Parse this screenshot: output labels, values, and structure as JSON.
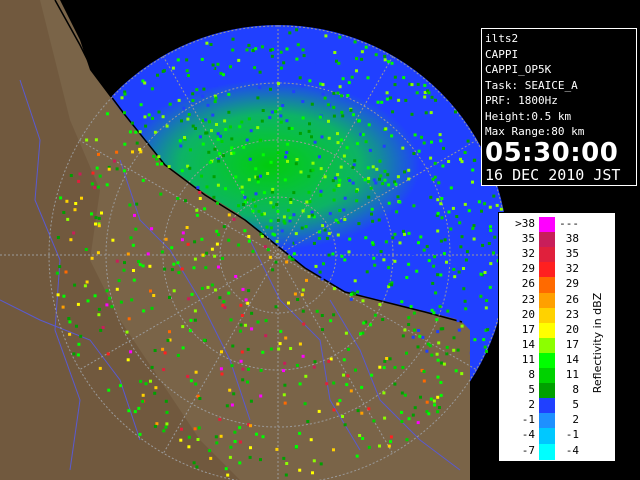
{
  "info": {
    "radar_name": "ilts2",
    "product": "CAPPI",
    "product_name": "CAPPI_OP5K",
    "task": "Task: SEAICE_A",
    "prf": "PRF: 1800Hz",
    "height": "Height:0.5 km",
    "max_range": "Max Range:80 km",
    "time": "05:30:00",
    "date": "16 DEC 2010 JST"
  },
  "legend": {
    "unit": "Reflectivity in dBZ",
    "rows": [
      {
        "lo": ">38",
        "hi": "---",
        "color": "#ff00ff"
      },
      {
        "lo": "35",
        "hi": "38",
        "color": "#c81e5a"
      },
      {
        "lo": "32",
        "hi": "35",
        "color": "#e0203c"
      },
      {
        "lo": "29",
        "hi": "32",
        "color": "#ff2020"
      },
      {
        "lo": "26",
        "hi": "29",
        "color": "#ff6a00"
      },
      {
        "lo": "23",
        "hi": "26",
        "color": "#ffa000"
      },
      {
        "lo": "20",
        "hi": "23",
        "color": "#ffd200"
      },
      {
        "lo": "17",
        "hi": "20",
        "color": "#ffff00"
      },
      {
        "lo": "14",
        "hi": "17",
        "color": "#8cff00"
      },
      {
        "lo": "11",
        "hi": "14",
        "color": "#00ff00"
      },
      {
        "lo": "8",
        "hi": "11",
        "color": "#00d200"
      },
      {
        "lo": "5",
        "hi": "8",
        "color": "#00a000"
      },
      {
        "lo": "2",
        "hi": "5",
        "color": "#2040ff"
      },
      {
        "lo": "-1",
        "hi": "2",
        "color": "#1e90ff"
      },
      {
        "lo": "-4",
        "hi": "-1",
        "color": "#00c8ff"
      },
      {
        "lo": "-7",
        "hi": "-4",
        "color": "#00ffff"
      }
    ]
  },
  "colors": {
    "sea_bg": "#2040ff",
    "land": "#7a6448",
    "rings": "#9a9a9a",
    "rivers": "#5a5ad0",
    "coast": "#000000"
  }
}
